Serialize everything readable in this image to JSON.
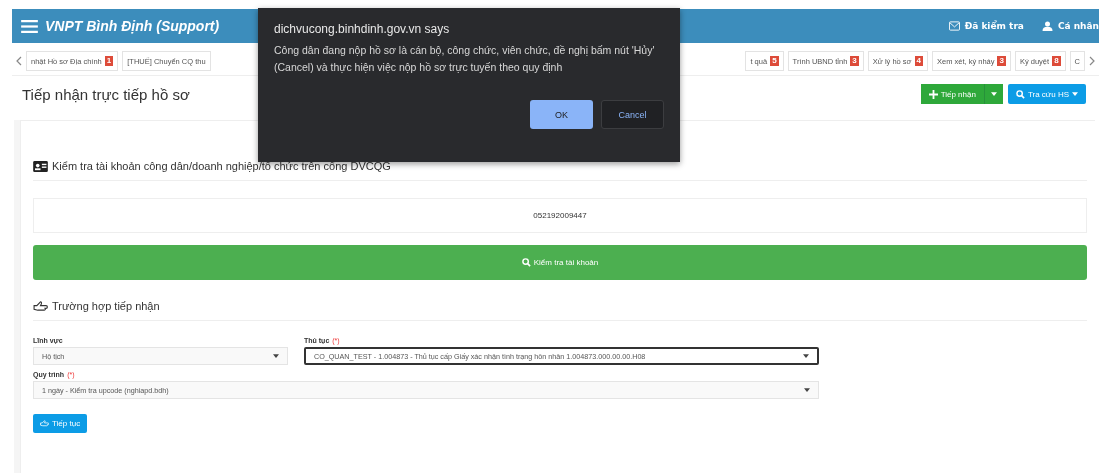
{
  "header": {
    "title": "VNPT Bình Định (Support)",
    "links": [
      {
        "kind": "mail",
        "label": "Đã kiểm tra"
      },
      {
        "kind": "user",
        "label": "Cá nhân"
      }
    ]
  },
  "tabs_left": [
    {
      "label": "nhật Hồ sơ Địa chính",
      "badge": "1"
    },
    {
      "label": "[THUẾ] Chuyển CQ thu"
    }
  ],
  "tabs_right": [
    {
      "label": "t quả",
      "badge": "5"
    },
    {
      "label": "Trình UBND tỉnh",
      "badge": "3"
    },
    {
      "label": "Xử lý hồ sơ",
      "badge": "4"
    },
    {
      "label": "Xem xét, ký nháy",
      "badge": "3"
    },
    {
      "label": "Ký duyệt",
      "badge": "8"
    },
    {
      "label": "C"
    }
  ],
  "page_title": "Tiếp nhận trực tiếp hồ sơ",
  "actions": [
    {
      "kind": "add",
      "label": "Tiếp nhận",
      "split": true
    },
    {
      "kind": "search",
      "label": "Tra cứu HS",
      "split": false
    }
  ],
  "account_check": {
    "heading": "Kiểm tra tài khoản công dân/doanh nghiệp/tổ chức trên cổng DVCQG",
    "value": "052192009447",
    "button": "Kiểm tra tài khoản"
  },
  "case": {
    "heading": "Trường hợp tiếp nhận",
    "fields": [
      {
        "label": "Lĩnh vực",
        "value": "Hộ tịch",
        "focused": false
      },
      {
        "label": "Thủ tục",
        "required_mark": "(*)",
        "value": "CO_QUAN_TEST - 1.004873 - Thủ tục cấp Giấy xác nhận tình trạng hôn nhân 1.004873.000.00.00.H08",
        "focused": true
      },
      {
        "label": "Quy trình",
        "required_mark": "(*)",
        "value": "1 ngày - Kiểm tra upcode (nghiapd.bdh)",
        "focused": false
      }
    ],
    "button": "Tiếp tục"
  },
  "dialog": {
    "origin": "dichvucong.binhdinh.gov.vn says",
    "message": "Công dân đang nộp hồ sơ là cán bộ, công chức, viên chức, đề nghị bấm nút 'Hủy' (Cancel) và thực hiện việc nộp hồ sơ trực tuyến theo quy định",
    "buttons": [
      {
        "label": "OK",
        "kind": "primary"
      },
      {
        "label": "Cancel",
        "kind": "secondary"
      }
    ]
  }
}
